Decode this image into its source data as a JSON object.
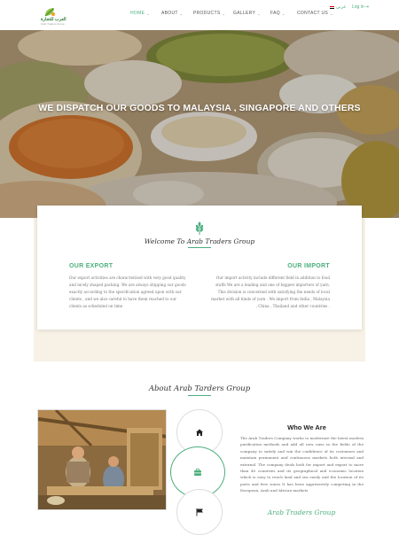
{
  "header": {
    "brand_ar": "العرب للتجارة",
    "brand_tag": "Arab Traders Group",
    "nav": [
      {
        "label": "HOME",
        "active": true
      },
      {
        "label": "ABOUT"
      },
      {
        "label": "PRODUCTS"
      },
      {
        "label": "GALLERY"
      },
      {
        "label": "FAQ"
      },
      {
        "label": "CONTACT US"
      }
    ],
    "language_label": "عربي",
    "login_label": "Log in"
  },
  "hero": {
    "title": "WE DISPATCH OUR GOODS TO MALAYSIA , SINGAPORE AND OTHERS"
  },
  "welcome": {
    "title": "Welcome To Arab Traders Group",
    "export_heading": "OUR EXPORT",
    "export_text": "Our export activities are characterized with very good quality and nicely shaped packing. We are always shipping our goods exactly according to the specification agreed upon with our clients , and we also careful to have them reached to our clients as scheduled on time",
    "import_heading": "OUR IMPORT",
    "import_text": "Our import activity include different field in addition to food stuffs We are a leading and one of biggest importers of yarn. This division is concerned with satisfying the needs of local market with all kinds of yarn . We import from India , Malaysia , China , Thailand and other countries ."
  },
  "about": {
    "title": "About Arab Tarders Group",
    "who_title": "Who We Are",
    "who_text": "The Arab Traders Company works to modernize the latest modern purification methods and add all new ones in the fields of the company to satisfy and win the confidence of its customers and maintain permanent and continuous markets both internal and external. The company deals both for import and export to more than 40 countries and its geographical and economic location which is easy to reach land and sea easily and the location of its ports and free zones It has been aggressively competing in the European, Arab and African markets",
    "signature": "Arab Traders Group",
    "icons": [
      "home-icon",
      "briefcase-icon",
      "flag-icon"
    ]
  },
  "colors": {
    "accent": "#4caf7d",
    "cream": "#f7f1e6"
  }
}
